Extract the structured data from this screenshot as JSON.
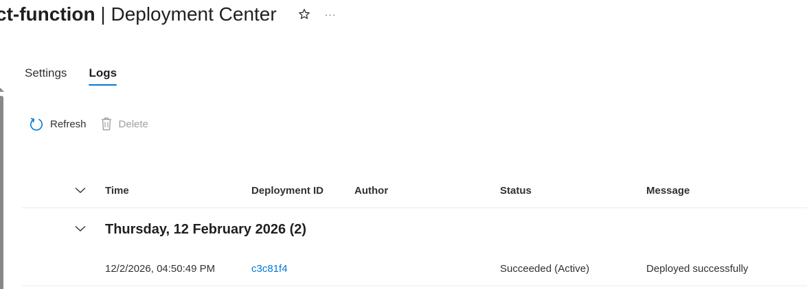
{
  "header": {
    "title_bold": "ct-function",
    "title_rest": " | Deployment Center",
    "star_icon": "star-outline-icon",
    "more_label": "···"
  },
  "tabs": [
    {
      "label": "Settings",
      "active": false
    },
    {
      "label": "Logs",
      "active": true
    }
  ],
  "toolbar": {
    "refresh_label": "Refresh",
    "delete_label": "Delete"
  },
  "grid": {
    "columns": {
      "time": "Time",
      "deployment_id": "Deployment ID",
      "author": "Author",
      "status": "Status",
      "message": "Message"
    },
    "groups": [
      {
        "title": "Thursday, 12 February 2026 (2)",
        "rows": [
          {
            "time": "12/2/2026, 04:50:49 PM",
            "deployment_id": "c3c81f4",
            "author": "",
            "status": "Succeeded (Active)",
            "message": "Deployed successfully"
          }
        ]
      }
    ]
  },
  "colors": {
    "accent": "#0078d4",
    "text": "#323130",
    "disabled": "#a19f9d",
    "divider": "#edebe9"
  }
}
